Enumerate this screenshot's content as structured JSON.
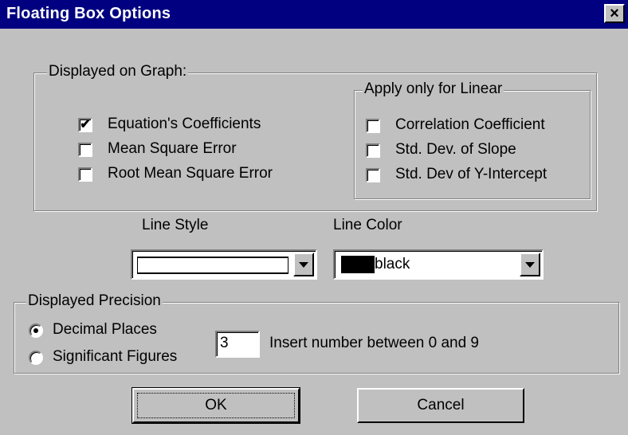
{
  "window": {
    "title": "Floating Box Options",
    "close_label": "×"
  },
  "displayed_group": {
    "label": "Displayed on Graph:",
    "items": [
      {
        "label": "Equation's Coefficients",
        "checked": true
      },
      {
        "label": "Mean Square Error",
        "checked": false
      },
      {
        "label": "Root Mean Square Error",
        "checked": false
      }
    ]
  },
  "linear_group": {
    "label": "Apply only for Linear",
    "items": [
      {
        "label": "Correlation Coefficient",
        "checked": false
      },
      {
        "label": "Std. Dev. of Slope",
        "checked": false
      },
      {
        "label": "Std. Dev of Y-Intercept",
        "checked": false
      }
    ]
  },
  "line_style": {
    "label": "Line Style"
  },
  "line_color": {
    "label": "Line Color",
    "value": "black",
    "swatch": "#000000"
  },
  "precision_group": {
    "label": "Displayed Precision",
    "options": [
      {
        "label": "Decimal Places",
        "selected": true
      },
      {
        "label": "Significant Figures",
        "selected": false
      }
    ],
    "value": "3",
    "hint": "Insert number between 0 and 9"
  },
  "buttons": {
    "ok": "OK",
    "cancel": "Cancel"
  },
  "check_mark": "✔"
}
